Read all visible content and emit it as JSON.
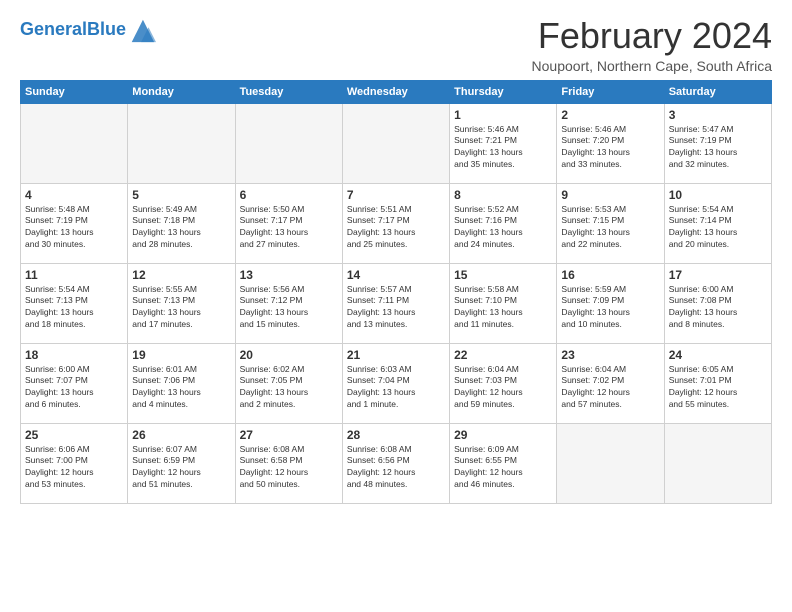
{
  "header": {
    "logo_general": "General",
    "logo_blue": "Blue",
    "month_title": "February 2024",
    "location": "Noupoort, Northern Cape, South Africa"
  },
  "days_of_week": [
    "Sunday",
    "Monday",
    "Tuesday",
    "Wednesday",
    "Thursday",
    "Friday",
    "Saturday"
  ],
  "weeks": [
    [
      {
        "day": "",
        "empty": true
      },
      {
        "day": "",
        "empty": true
      },
      {
        "day": "",
        "empty": true
      },
      {
        "day": "",
        "empty": true
      },
      {
        "day": "1",
        "info": "Sunrise: 5:46 AM\nSunset: 7:21 PM\nDaylight: 13 hours\nand 35 minutes."
      },
      {
        "day": "2",
        "info": "Sunrise: 5:46 AM\nSunset: 7:20 PM\nDaylight: 13 hours\nand 33 minutes."
      },
      {
        "day": "3",
        "info": "Sunrise: 5:47 AM\nSunset: 7:19 PM\nDaylight: 13 hours\nand 32 minutes."
      }
    ],
    [
      {
        "day": "4",
        "info": "Sunrise: 5:48 AM\nSunset: 7:19 PM\nDaylight: 13 hours\nand 30 minutes."
      },
      {
        "day": "5",
        "info": "Sunrise: 5:49 AM\nSunset: 7:18 PM\nDaylight: 13 hours\nand 28 minutes."
      },
      {
        "day": "6",
        "info": "Sunrise: 5:50 AM\nSunset: 7:17 PM\nDaylight: 13 hours\nand 27 minutes."
      },
      {
        "day": "7",
        "info": "Sunrise: 5:51 AM\nSunset: 7:17 PM\nDaylight: 13 hours\nand 25 minutes."
      },
      {
        "day": "8",
        "info": "Sunrise: 5:52 AM\nSunset: 7:16 PM\nDaylight: 13 hours\nand 24 minutes."
      },
      {
        "day": "9",
        "info": "Sunrise: 5:53 AM\nSunset: 7:15 PM\nDaylight: 13 hours\nand 22 minutes."
      },
      {
        "day": "10",
        "info": "Sunrise: 5:54 AM\nSunset: 7:14 PM\nDaylight: 13 hours\nand 20 minutes."
      }
    ],
    [
      {
        "day": "11",
        "info": "Sunrise: 5:54 AM\nSunset: 7:13 PM\nDaylight: 13 hours\nand 18 minutes."
      },
      {
        "day": "12",
        "info": "Sunrise: 5:55 AM\nSunset: 7:13 PM\nDaylight: 13 hours\nand 17 minutes."
      },
      {
        "day": "13",
        "info": "Sunrise: 5:56 AM\nSunset: 7:12 PM\nDaylight: 13 hours\nand 15 minutes."
      },
      {
        "day": "14",
        "info": "Sunrise: 5:57 AM\nSunset: 7:11 PM\nDaylight: 13 hours\nand 13 minutes."
      },
      {
        "day": "15",
        "info": "Sunrise: 5:58 AM\nSunset: 7:10 PM\nDaylight: 13 hours\nand 11 minutes."
      },
      {
        "day": "16",
        "info": "Sunrise: 5:59 AM\nSunset: 7:09 PM\nDaylight: 13 hours\nand 10 minutes."
      },
      {
        "day": "17",
        "info": "Sunrise: 6:00 AM\nSunset: 7:08 PM\nDaylight: 13 hours\nand 8 minutes."
      }
    ],
    [
      {
        "day": "18",
        "info": "Sunrise: 6:00 AM\nSunset: 7:07 PM\nDaylight: 13 hours\nand 6 minutes."
      },
      {
        "day": "19",
        "info": "Sunrise: 6:01 AM\nSunset: 7:06 PM\nDaylight: 13 hours\nand 4 minutes."
      },
      {
        "day": "20",
        "info": "Sunrise: 6:02 AM\nSunset: 7:05 PM\nDaylight: 13 hours\nand 2 minutes."
      },
      {
        "day": "21",
        "info": "Sunrise: 6:03 AM\nSunset: 7:04 PM\nDaylight: 13 hours\nand 1 minute."
      },
      {
        "day": "22",
        "info": "Sunrise: 6:04 AM\nSunset: 7:03 PM\nDaylight: 12 hours\nand 59 minutes."
      },
      {
        "day": "23",
        "info": "Sunrise: 6:04 AM\nSunset: 7:02 PM\nDaylight: 12 hours\nand 57 minutes."
      },
      {
        "day": "24",
        "info": "Sunrise: 6:05 AM\nSunset: 7:01 PM\nDaylight: 12 hours\nand 55 minutes."
      }
    ],
    [
      {
        "day": "25",
        "info": "Sunrise: 6:06 AM\nSunset: 7:00 PM\nDaylight: 12 hours\nand 53 minutes."
      },
      {
        "day": "26",
        "info": "Sunrise: 6:07 AM\nSunset: 6:59 PM\nDaylight: 12 hours\nand 51 minutes."
      },
      {
        "day": "27",
        "info": "Sunrise: 6:08 AM\nSunset: 6:58 PM\nDaylight: 12 hours\nand 50 minutes."
      },
      {
        "day": "28",
        "info": "Sunrise: 6:08 AM\nSunset: 6:56 PM\nDaylight: 12 hours\nand 48 minutes."
      },
      {
        "day": "29",
        "info": "Sunrise: 6:09 AM\nSunset: 6:55 PM\nDaylight: 12 hours\nand 46 minutes."
      },
      {
        "day": "",
        "empty": true
      },
      {
        "day": "",
        "empty": true
      }
    ]
  ]
}
